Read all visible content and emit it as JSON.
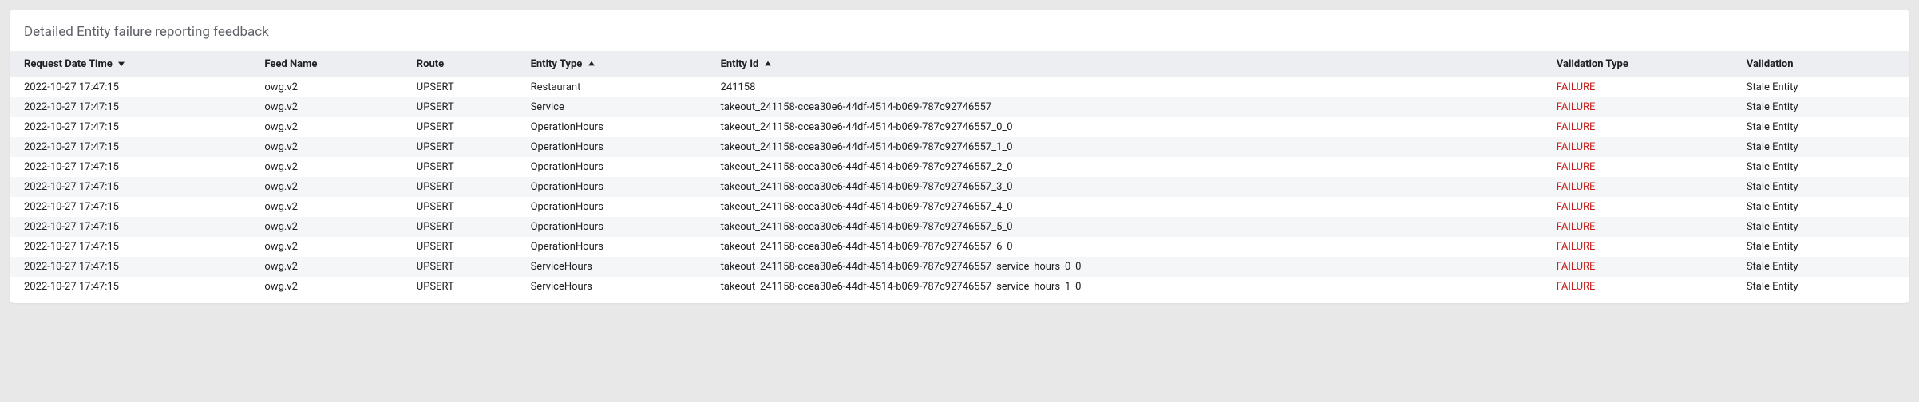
{
  "card": {
    "title": "Detailed Entity failure reporting feedback"
  },
  "columns": {
    "request_date_time": "Request Date Time",
    "feed_name": "Feed Name",
    "route": "Route",
    "entity_type": "Entity Type",
    "entity_id": "Entity Id",
    "validation_type": "Validation Type",
    "validation": "Validation"
  },
  "sort": {
    "request_date_time": "desc",
    "entity_type": "asc",
    "entity_id": "asc"
  },
  "rows": [
    {
      "request_date_time": "2022-10-27 17:47:15",
      "feed_name": "owg.v2",
      "route": "UPSERT",
      "entity_type": "Restaurant",
      "entity_id": "241158",
      "validation_type": "FAILURE",
      "validation": "Stale Entity"
    },
    {
      "request_date_time": "2022-10-27 17:47:15",
      "feed_name": "owg.v2",
      "route": "UPSERT",
      "entity_type": "Service",
      "entity_id": "takeout_241158-ccea30e6-44df-4514-b069-787c92746557",
      "validation_type": "FAILURE",
      "validation": "Stale Entity"
    },
    {
      "request_date_time": "2022-10-27 17:47:15",
      "feed_name": "owg.v2",
      "route": "UPSERT",
      "entity_type": "OperationHours",
      "entity_id": "takeout_241158-ccea30e6-44df-4514-b069-787c92746557_0_0",
      "validation_type": "FAILURE",
      "validation": "Stale Entity"
    },
    {
      "request_date_time": "2022-10-27 17:47:15",
      "feed_name": "owg.v2",
      "route": "UPSERT",
      "entity_type": "OperationHours",
      "entity_id": "takeout_241158-ccea30e6-44df-4514-b069-787c92746557_1_0",
      "validation_type": "FAILURE",
      "validation": "Stale Entity"
    },
    {
      "request_date_time": "2022-10-27 17:47:15",
      "feed_name": "owg.v2",
      "route": "UPSERT",
      "entity_type": "OperationHours",
      "entity_id": "takeout_241158-ccea30e6-44df-4514-b069-787c92746557_2_0",
      "validation_type": "FAILURE",
      "validation": "Stale Entity"
    },
    {
      "request_date_time": "2022-10-27 17:47:15",
      "feed_name": "owg.v2",
      "route": "UPSERT",
      "entity_type": "OperationHours",
      "entity_id": "takeout_241158-ccea30e6-44df-4514-b069-787c92746557_3_0",
      "validation_type": "FAILURE",
      "validation": "Stale Entity"
    },
    {
      "request_date_time": "2022-10-27 17:47:15",
      "feed_name": "owg.v2",
      "route": "UPSERT",
      "entity_type": "OperationHours",
      "entity_id": "takeout_241158-ccea30e6-44df-4514-b069-787c92746557_4_0",
      "validation_type": "FAILURE",
      "validation": "Stale Entity"
    },
    {
      "request_date_time": "2022-10-27 17:47:15",
      "feed_name": "owg.v2",
      "route": "UPSERT",
      "entity_type": "OperationHours",
      "entity_id": "takeout_241158-ccea30e6-44df-4514-b069-787c92746557_5_0",
      "validation_type": "FAILURE",
      "validation": "Stale Entity"
    },
    {
      "request_date_time": "2022-10-27 17:47:15",
      "feed_name": "owg.v2",
      "route": "UPSERT",
      "entity_type": "OperationHours",
      "entity_id": "takeout_241158-ccea30e6-44df-4514-b069-787c92746557_6_0",
      "validation_type": "FAILURE",
      "validation": "Stale Entity"
    },
    {
      "request_date_time": "2022-10-27 17:47:15",
      "feed_name": "owg.v2",
      "route": "UPSERT",
      "entity_type": "ServiceHours",
      "entity_id": "takeout_241158-ccea30e6-44df-4514-b069-787c92746557_service_hours_0_0",
      "validation_type": "FAILURE",
      "validation": "Stale Entity"
    },
    {
      "request_date_time": "2022-10-27 17:47:15",
      "feed_name": "owg.v2",
      "route": "UPSERT",
      "entity_type": "ServiceHours",
      "entity_id": "takeout_241158-ccea30e6-44df-4514-b069-787c92746557_service_hours_1_0",
      "validation_type": "FAILURE",
      "validation": "Stale Entity"
    }
  ]
}
